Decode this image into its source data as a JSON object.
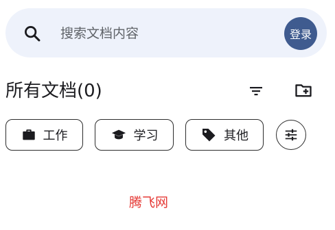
{
  "search": {
    "placeholder": "搜索文档内容",
    "login_label": "登录"
  },
  "header": {
    "title": "所有文档(0)",
    "sort_icon": "filter-list-icon",
    "new_folder_icon": "create-new-folder-icon"
  },
  "categories": [
    {
      "label": "工作",
      "icon": "briefcase-icon"
    },
    {
      "label": "学习",
      "icon": "graduation-cap-icon"
    },
    {
      "label": "其他",
      "icon": "tag-icon"
    }
  ],
  "filter_settings_icon": "tune-icon",
  "watermark": "腾飞网",
  "colors": {
    "search_bg": "#eef2fb",
    "login_bg": "#3f5b8f",
    "watermark": "#e53935"
  }
}
